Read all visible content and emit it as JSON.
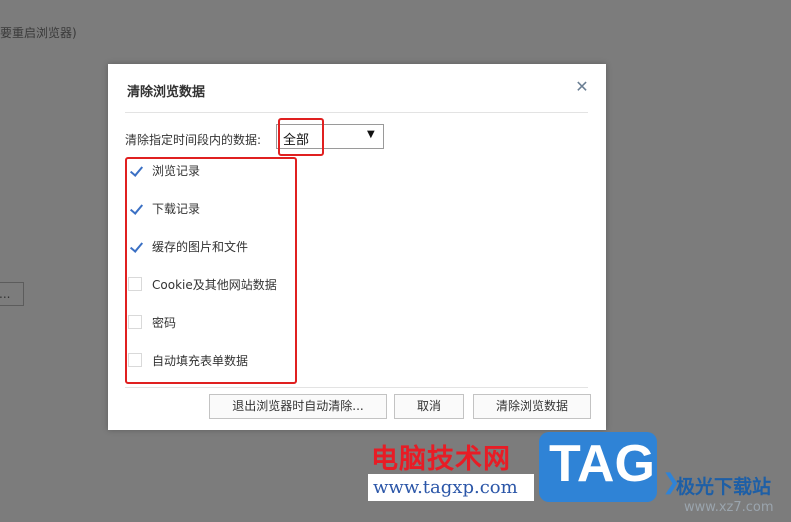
{
  "background": {
    "hint_text": "要重启浏览器)",
    "button_text": "..."
  },
  "dialog": {
    "title": "清除浏览数据",
    "close_glyph": "✕",
    "range_label": "清除指定时间段内的数据:",
    "range_selected": "全部",
    "range_arrow": "▼",
    "options": [
      {
        "label": "浏览记录",
        "checked": true
      },
      {
        "label": "下载记录",
        "checked": true
      },
      {
        "label": "缓存的图片和文件",
        "checked": true
      },
      {
        "label": "Cookie及其他网站数据",
        "checked": false
      },
      {
        "label": "密码",
        "checked": false
      },
      {
        "label": "自动填充表单数据",
        "checked": false
      }
    ],
    "buttons": {
      "auto_clear": "退出浏览器时自动清除...",
      "cancel": "取消",
      "clear": "清除浏览数据"
    }
  },
  "watermark": {
    "site_name": "电脑技术网",
    "site_url": "www.tagxp.com",
    "logo_text": "TAG",
    "second_name": "极光下载站",
    "second_url": "www.xz7.com"
  },
  "colors": {
    "highlight": "#e02020",
    "check": "#3b70c4"
  }
}
